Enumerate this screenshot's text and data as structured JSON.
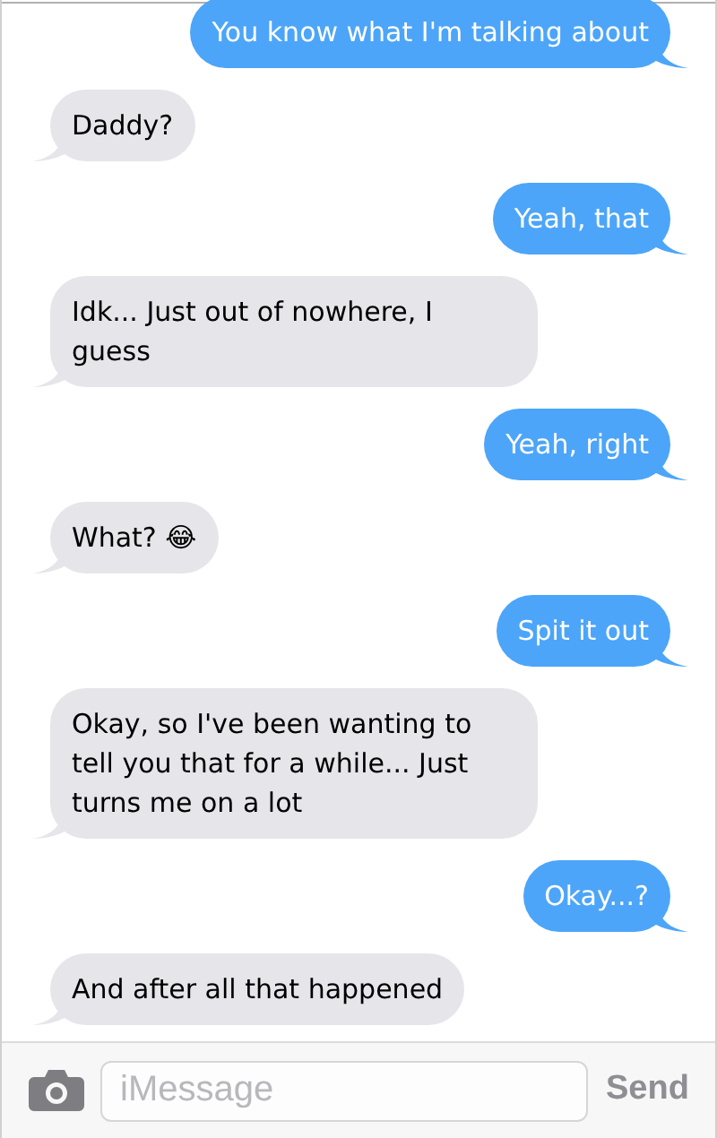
{
  "messages": [
    {
      "kind": "sent",
      "text": "You know what I'm talking about"
    },
    {
      "kind": "received",
      "text": "Daddy?"
    },
    {
      "kind": "sent",
      "text": "Yeah, that"
    },
    {
      "kind": "received",
      "text": "Idk... Just out of nowhere, I guess"
    },
    {
      "kind": "sent",
      "text": "Yeah, right"
    },
    {
      "kind": "received",
      "text": "What? 😂"
    },
    {
      "kind": "sent",
      "text": "Spit it out"
    },
    {
      "kind": "received",
      "text": "Okay, so I've been wanting to tell you that for a while... Just turns me on a lot"
    },
    {
      "kind": "sent",
      "text": "Okay...?"
    },
    {
      "kind": "received",
      "text": "And after all that happened"
    }
  ],
  "composer": {
    "placeholder": "iMessage",
    "send": "Send"
  }
}
